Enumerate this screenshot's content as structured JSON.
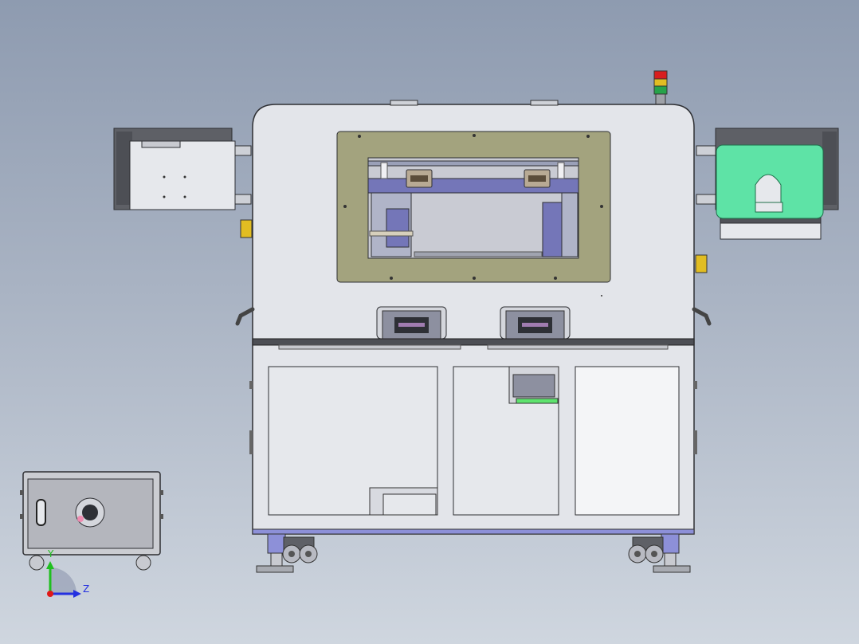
{
  "triad": {
    "y_label": "Y",
    "z_label": "Z"
  },
  "colors": {
    "background_top": "#8e9bb0",
    "background_bottom": "#cfd6df",
    "cabinet_body": "#e3e5ea",
    "window_frame": "#a3a37e",
    "green_guard": "#5ee3a6",
    "signal_red": "#d81e1e",
    "signal_yellow": "#e1bd22",
    "signal_green": "#27a34a",
    "caster_blue": "#8d90d8",
    "triad_y": "#1fbf1f",
    "triad_z": "#2430e0",
    "triad_x": "#e01818"
  },
  "icons": {
    "triad": "xyz-triad-icon",
    "signal_tower": "signal-tower-icon",
    "viewport": "cad-assembly-model"
  }
}
